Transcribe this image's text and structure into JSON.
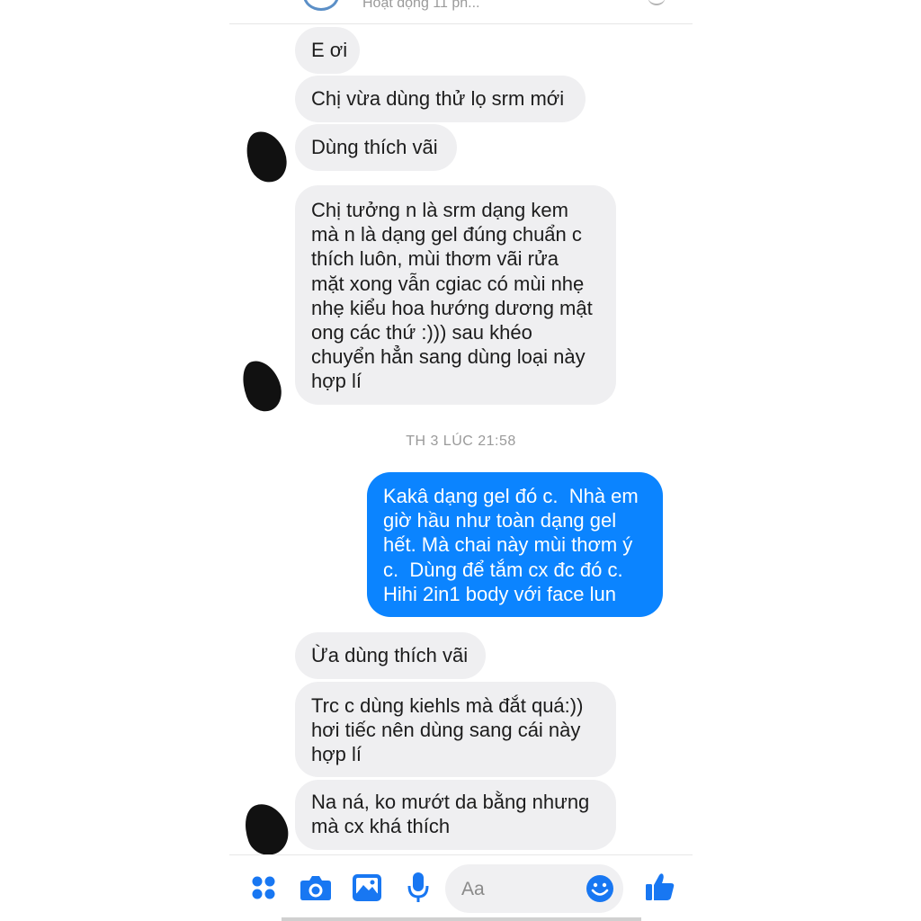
{
  "header": {
    "status": "Hoạt động 11 ph..."
  },
  "messages": [
    {
      "from": "them",
      "text": "E ơi"
    },
    {
      "from": "them",
      "text": "Chị vừa dùng thử lọ srm mới"
    },
    {
      "from": "them",
      "text": "Dùng thích vãi"
    },
    {
      "from": "them",
      "text": "Chị tưởng n là srm dạng kem\nmà n là dạng gel đúng chuẩn c\nthích luôn, mùi thơm vãi rửa\nmặt xong vẫn cgiac có mùi nhẹ\nnhẹ kiểu hoa hướng dương mật\nong các thứ :))) sau khéo\nchuyển hẳn sang dùng loại này\nhợp lí"
    },
    {
      "from": "me",
      "text": "Kakâ dạng gel đó c.  Nhà em\ngiờ hầu như toàn dạng gel\nhết. Mà chai này mùi thơm ý\nc.  Dùng để tắm cx đc đó c.\nHihi 2in1 body với face lun"
    },
    {
      "from": "them",
      "text": "Ừa dùng thích vãi"
    },
    {
      "from": "them",
      "text": "Trc c dùng kiehls mà đắt quá:))\nhơi tiếc nên dùng sang cái này\nhợp lí"
    },
    {
      "from": "them",
      "text": "Na ná, ko mướt da bằng nhưng\nmà cx khá thích"
    }
  ],
  "timestamp": "TH 3 LÚC 21:58",
  "composer": {
    "placeholder": "Aa"
  },
  "toolbar": {
    "icons": [
      "apps-icon",
      "camera-icon",
      "image-icon",
      "microphone-icon",
      "emoji-icon",
      "like-icon"
    ]
  },
  "colors": {
    "accent": "#0b84ff",
    "incoming_bubble": "#efeff1",
    "icon_blue": "#1877f2"
  }
}
